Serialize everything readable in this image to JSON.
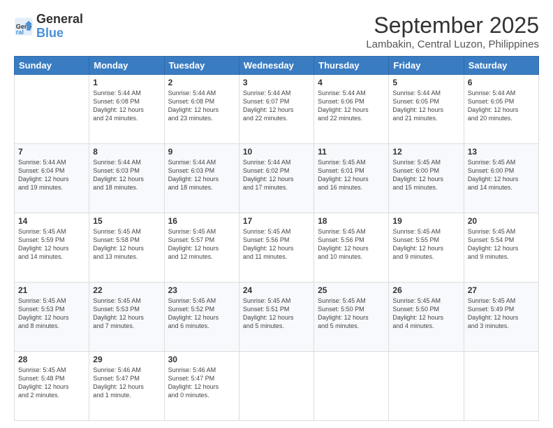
{
  "logo": {
    "line1": "General",
    "line2": "Blue"
  },
  "title": "September 2025",
  "subtitle": "Lambakin, Central Luzon, Philippines",
  "days_header": [
    "Sunday",
    "Monday",
    "Tuesday",
    "Wednesday",
    "Thursday",
    "Friday",
    "Saturday"
  ],
  "weeks": [
    [
      {
        "day": "",
        "info": ""
      },
      {
        "day": "1",
        "info": "Sunrise: 5:44 AM\nSunset: 6:08 PM\nDaylight: 12 hours\nand 24 minutes."
      },
      {
        "day": "2",
        "info": "Sunrise: 5:44 AM\nSunset: 6:08 PM\nDaylight: 12 hours\nand 23 minutes."
      },
      {
        "day": "3",
        "info": "Sunrise: 5:44 AM\nSunset: 6:07 PM\nDaylight: 12 hours\nand 22 minutes."
      },
      {
        "day": "4",
        "info": "Sunrise: 5:44 AM\nSunset: 6:06 PM\nDaylight: 12 hours\nand 22 minutes."
      },
      {
        "day": "5",
        "info": "Sunrise: 5:44 AM\nSunset: 6:05 PM\nDaylight: 12 hours\nand 21 minutes."
      },
      {
        "day": "6",
        "info": "Sunrise: 5:44 AM\nSunset: 6:05 PM\nDaylight: 12 hours\nand 20 minutes."
      }
    ],
    [
      {
        "day": "7",
        "info": "Sunrise: 5:44 AM\nSunset: 6:04 PM\nDaylight: 12 hours\nand 19 minutes."
      },
      {
        "day": "8",
        "info": "Sunrise: 5:44 AM\nSunset: 6:03 PM\nDaylight: 12 hours\nand 18 minutes."
      },
      {
        "day": "9",
        "info": "Sunrise: 5:44 AM\nSunset: 6:03 PM\nDaylight: 12 hours\nand 18 minutes."
      },
      {
        "day": "10",
        "info": "Sunrise: 5:44 AM\nSunset: 6:02 PM\nDaylight: 12 hours\nand 17 minutes."
      },
      {
        "day": "11",
        "info": "Sunrise: 5:45 AM\nSunset: 6:01 PM\nDaylight: 12 hours\nand 16 minutes."
      },
      {
        "day": "12",
        "info": "Sunrise: 5:45 AM\nSunset: 6:00 PM\nDaylight: 12 hours\nand 15 minutes."
      },
      {
        "day": "13",
        "info": "Sunrise: 5:45 AM\nSunset: 6:00 PM\nDaylight: 12 hours\nand 14 minutes."
      }
    ],
    [
      {
        "day": "14",
        "info": "Sunrise: 5:45 AM\nSunset: 5:59 PM\nDaylight: 12 hours\nand 14 minutes."
      },
      {
        "day": "15",
        "info": "Sunrise: 5:45 AM\nSunset: 5:58 PM\nDaylight: 12 hours\nand 13 minutes."
      },
      {
        "day": "16",
        "info": "Sunrise: 5:45 AM\nSunset: 5:57 PM\nDaylight: 12 hours\nand 12 minutes."
      },
      {
        "day": "17",
        "info": "Sunrise: 5:45 AM\nSunset: 5:56 PM\nDaylight: 12 hours\nand 11 minutes."
      },
      {
        "day": "18",
        "info": "Sunrise: 5:45 AM\nSunset: 5:56 PM\nDaylight: 12 hours\nand 10 minutes."
      },
      {
        "day": "19",
        "info": "Sunrise: 5:45 AM\nSunset: 5:55 PM\nDaylight: 12 hours\nand 9 minutes."
      },
      {
        "day": "20",
        "info": "Sunrise: 5:45 AM\nSunset: 5:54 PM\nDaylight: 12 hours\nand 9 minutes."
      }
    ],
    [
      {
        "day": "21",
        "info": "Sunrise: 5:45 AM\nSunset: 5:53 PM\nDaylight: 12 hours\nand 8 minutes."
      },
      {
        "day": "22",
        "info": "Sunrise: 5:45 AM\nSunset: 5:53 PM\nDaylight: 12 hours\nand 7 minutes."
      },
      {
        "day": "23",
        "info": "Sunrise: 5:45 AM\nSunset: 5:52 PM\nDaylight: 12 hours\nand 6 minutes."
      },
      {
        "day": "24",
        "info": "Sunrise: 5:45 AM\nSunset: 5:51 PM\nDaylight: 12 hours\nand 5 minutes."
      },
      {
        "day": "25",
        "info": "Sunrise: 5:45 AM\nSunset: 5:50 PM\nDaylight: 12 hours\nand 5 minutes."
      },
      {
        "day": "26",
        "info": "Sunrise: 5:45 AM\nSunset: 5:50 PM\nDaylight: 12 hours\nand 4 minutes."
      },
      {
        "day": "27",
        "info": "Sunrise: 5:45 AM\nSunset: 5:49 PM\nDaylight: 12 hours\nand 3 minutes."
      }
    ],
    [
      {
        "day": "28",
        "info": "Sunrise: 5:45 AM\nSunset: 5:48 PM\nDaylight: 12 hours\nand 2 minutes."
      },
      {
        "day": "29",
        "info": "Sunrise: 5:46 AM\nSunset: 5:47 PM\nDaylight: 12 hours\nand 1 minute."
      },
      {
        "day": "30",
        "info": "Sunrise: 5:46 AM\nSunset: 5:47 PM\nDaylight: 12 hours\nand 0 minutes."
      },
      {
        "day": "",
        "info": ""
      },
      {
        "day": "",
        "info": ""
      },
      {
        "day": "",
        "info": ""
      },
      {
        "day": "",
        "info": ""
      }
    ]
  ]
}
